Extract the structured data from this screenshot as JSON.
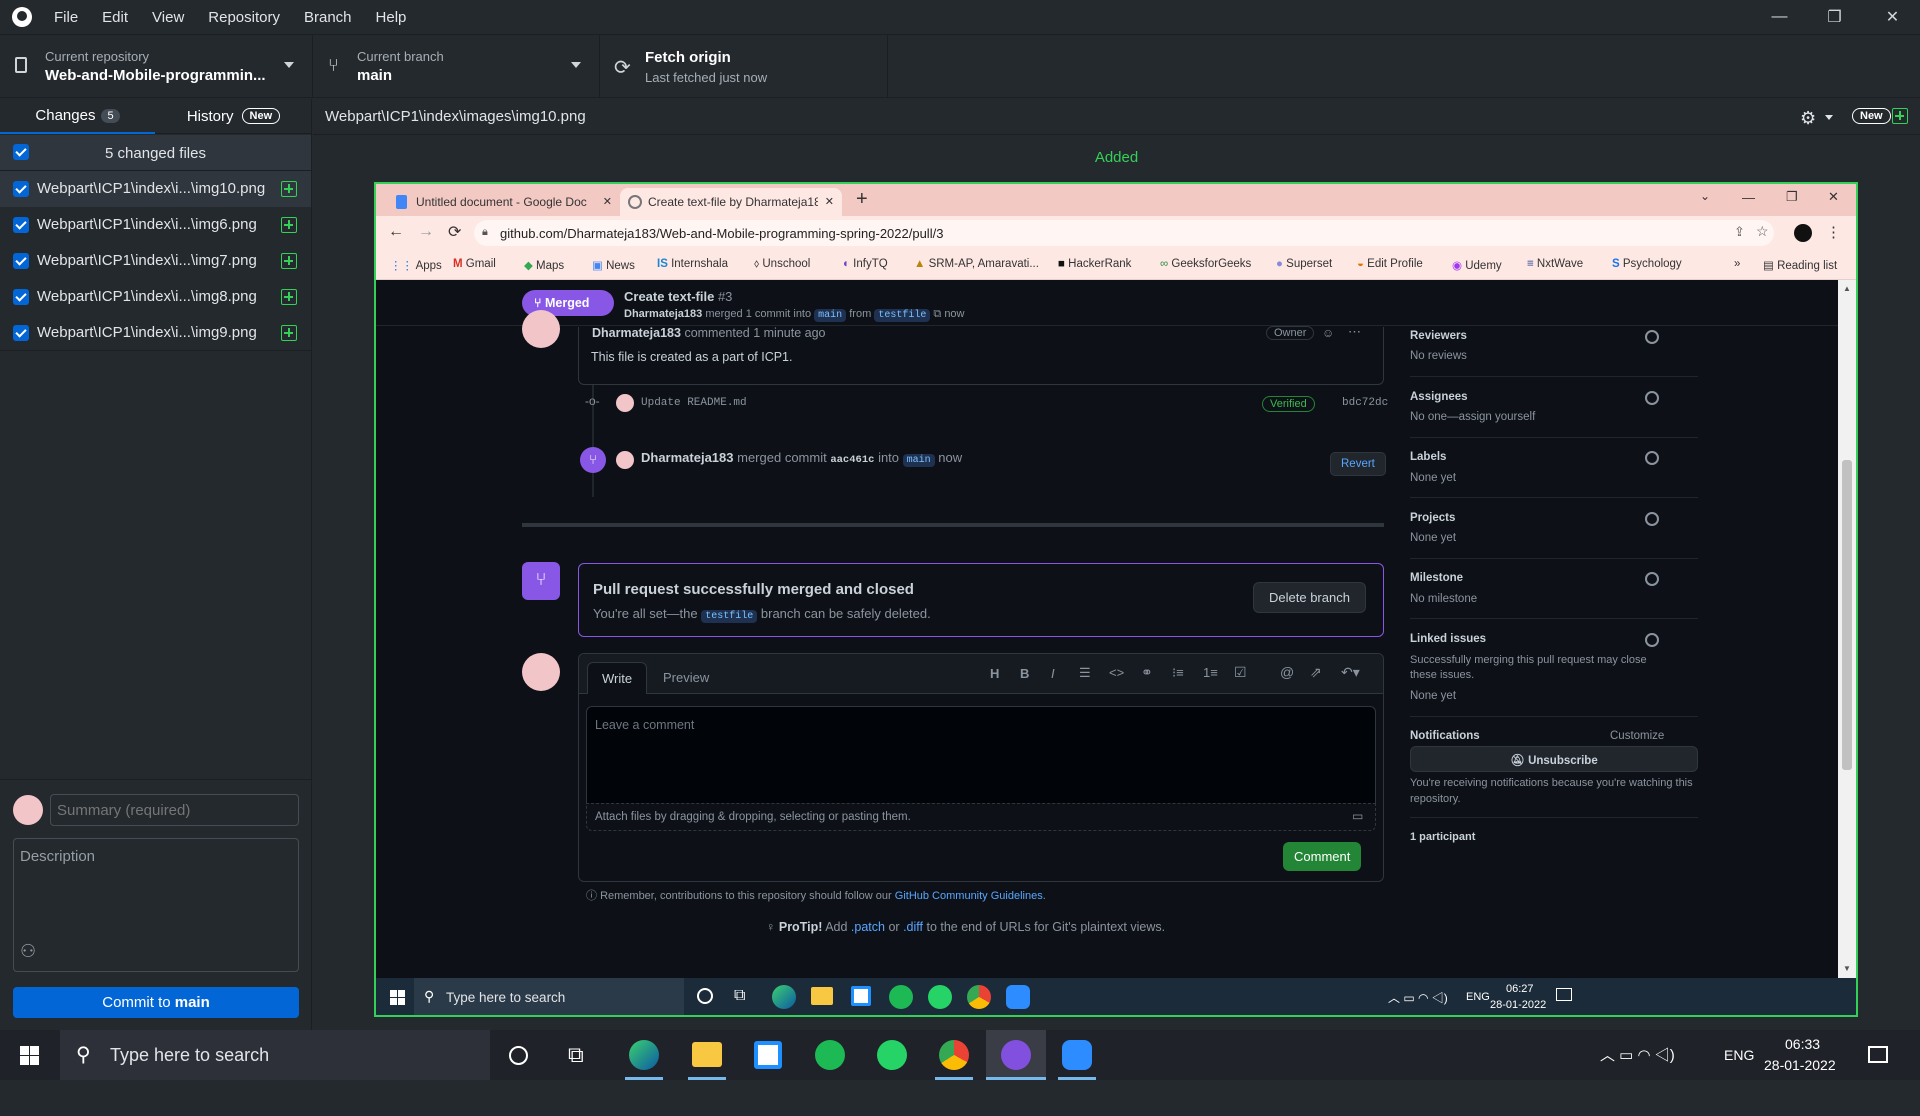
{
  "menu": [
    "File",
    "Edit",
    "View",
    "Repository",
    "Branch",
    "Help"
  ],
  "toolbar": {
    "repo_label": "Current repository",
    "repo_value": "Web-and-Mobile-programmin...",
    "branch_label": "Current branch",
    "branch_value": "main",
    "fetch_label": "Fetch origin",
    "fetch_sub": "Last fetched just now"
  },
  "sidebar": {
    "tab_changes": "Changes",
    "changes_count": "5",
    "tab_history": "History",
    "history_badge": "New",
    "changed_files_label": "5 changed files",
    "files": [
      "Webpart\\ICP1\\index\\i...\\img10.png",
      "Webpart\\ICP1\\index\\i...\\img6.png",
      "Webpart\\ICP1\\index\\i...\\img7.png",
      "Webpart\\ICP1\\index\\i...\\img8.png",
      "Webpart\\ICP1\\index\\i...\\img9.png"
    ],
    "summary_placeholder": "Summary (required)",
    "description_placeholder": "Description",
    "commit_prefix": "Commit to ",
    "commit_branch": "main"
  },
  "diff": {
    "path": "Webpart\\ICP1\\index\\images\\img10.png",
    "new_badge": "New",
    "status": "Added"
  },
  "browser": {
    "tab1": "Untitled document - Google Doc",
    "tab2": "Create text-file by Dharmateja18",
    "url": "github.com/Dharmateja183/Web-and-Mobile-programming-spring-2022/pull/3",
    "bookmarks": [
      "Apps",
      "Gmail",
      "Maps",
      "News",
      "Internshala",
      "Unschool",
      "InfyTQ",
      "SRM-AP, Amaravati...",
      "HackerRank",
      "GeeksforGeeks",
      "Superset",
      "Edit Profile",
      "Udemy",
      "NxtWave",
      "Psychology"
    ],
    "reading_list": "Reading list",
    "more": "»"
  },
  "pr": {
    "state": "Merged",
    "title": "Create text-file",
    "number": "#3",
    "meta_user": "Dharmateja183",
    "meta_mid": "merged 1 commit into",
    "base": "main",
    "meta_from": "from",
    "head": "testfile",
    "meta_time": "now",
    "comment_author": "Dharmateja183",
    "comment_time": "commented 1 minute ago",
    "owner_badge": "Owner",
    "comment_body": "This file is created as a part of ICP1.",
    "commit_msg": "Update README.md",
    "verified": "Verified",
    "commit_sha": "bdc72dc",
    "merge_user": "Dharmateja183",
    "merge_text1": "merged commit",
    "merge_sha": "aac461c",
    "merge_text2": "into",
    "merge_base": "main",
    "merge_time": "now",
    "revert": "Revert",
    "merged_title": "Pull request successfully merged and closed",
    "merged_sub1": "You're all set—the",
    "merged_branch": "testfile",
    "merged_sub2": "branch can be safely deleted.",
    "delete_branch": "Delete branch",
    "write_tab": "Write",
    "preview_tab": "Preview",
    "comment_placeholder": "Leave a comment",
    "attach_hint": "Attach files by dragging & dropping, selecting or pasting them.",
    "comment_button": "Comment",
    "remember_text": "Remember, contributions to this repository should follow our",
    "guidelines_link": "GitHub Community Guidelines",
    "protip_label": "ProTip!",
    "protip_text1": "Add",
    "protip_patch": ".patch",
    "protip_or": "or",
    "protip_diff": ".diff",
    "protip_text2": "to the end of URLs for Git's plaintext views."
  },
  "pr_sidebar": {
    "reviewers": "Reviewers",
    "reviewers_v": "No reviews",
    "assignees": "Assignees",
    "assignees_v": "No one—assign yourself",
    "labels": "Labels",
    "labels_v": "None yet",
    "projects": "Projects",
    "projects_v": "None yet",
    "milestone": "Milestone",
    "milestone_v": "No milestone",
    "linked": "Linked issues",
    "linked_desc": "Successfully merging this pull request may close these issues.",
    "linked_v": "None yet",
    "notifications": "Notifications",
    "customize": "Customize",
    "unsubscribe": "Unsubscribe",
    "notif_desc": "You're receiving notifications because you're watching this repository.",
    "participants": "1 participant"
  },
  "inner_taskbar": {
    "search": "Type here to search",
    "lang": "ENG",
    "time": "06:27",
    "date": "28-01-2022"
  },
  "taskbar": {
    "search": "Type here to search",
    "lang": "ENG",
    "time": "06:33",
    "date": "28-01-2022"
  },
  "colors": {
    "accent_blue": "#0366d6",
    "added_green": "#34d058",
    "merged_purple": "#8957e5",
    "comment_green": "#238636"
  }
}
